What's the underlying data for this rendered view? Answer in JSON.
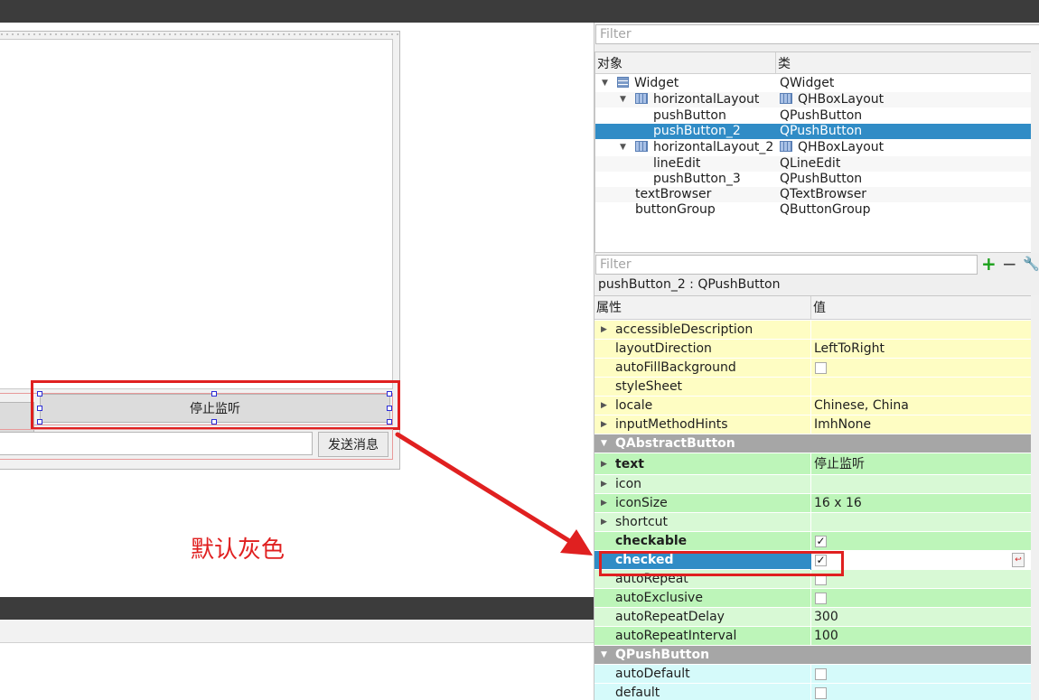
{
  "canvas": {
    "stop_button_label": "停止监听",
    "send_button_label": "发送消息",
    "annotation": "默认灰色"
  },
  "object_inspector": {
    "filter_placeholder": "Filter",
    "header_object": "对象",
    "header_class": "类",
    "rows": [
      {
        "name": "Widget",
        "class": "QWidget"
      },
      {
        "name": "horizontalLayout",
        "class": "QHBoxLayout"
      },
      {
        "name": "pushButton",
        "class": "QPushButton"
      },
      {
        "name": "pushButton_2",
        "class": "QPushButton"
      },
      {
        "name": "horizontalLayout_2",
        "class": "QHBoxLayout"
      },
      {
        "name": "lineEdit",
        "class": "QLineEdit"
      },
      {
        "name": "pushButton_3",
        "class": "QPushButton"
      },
      {
        "name": "textBrowser",
        "class": "QTextBrowser"
      },
      {
        "name": "buttonGroup",
        "class": "QButtonGroup"
      }
    ]
  },
  "property_editor": {
    "filter_placeholder": "Filter",
    "object_label": "pushButton_2 : QPushButton",
    "header_property": "属性",
    "header_value": "值",
    "rows": [
      {
        "name": "accessibleDescription",
        "value": ""
      },
      {
        "name": "layoutDirection",
        "value": "LeftToRight"
      },
      {
        "name": "autoFillBackground",
        "value": ""
      },
      {
        "name": "styleSheet",
        "value": ""
      },
      {
        "name": "locale",
        "value": "Chinese, China"
      },
      {
        "name": "inputMethodHints",
        "value": "ImhNone"
      },
      {
        "name": "QAbstractButton",
        "value": ""
      },
      {
        "name": "text",
        "value": "停止监听"
      },
      {
        "name": "icon",
        "value": ""
      },
      {
        "name": "iconSize",
        "value": "16 x 16"
      },
      {
        "name": "shortcut",
        "value": ""
      },
      {
        "name": "checkable",
        "value": "✓"
      },
      {
        "name": "checked",
        "value": "✓"
      },
      {
        "name": "autoRepeat",
        "value": ""
      },
      {
        "name": "autoExclusive",
        "value": ""
      },
      {
        "name": "autoRepeatDelay",
        "value": "300"
      },
      {
        "name": "autoRepeatInterval",
        "value": "100"
      },
      {
        "name": "QPushButton",
        "value": ""
      },
      {
        "name": "autoDefault",
        "value": ""
      },
      {
        "name": "default",
        "value": ""
      }
    ]
  },
  "colors": {
    "annotation_red": "#e02020",
    "selection_blue": "#308cc6",
    "qobject_yellow": "#fefdc3",
    "qabstractbutton_green": "#bdf5b9",
    "qpushbutton_cyan": "#d5fafa"
  }
}
